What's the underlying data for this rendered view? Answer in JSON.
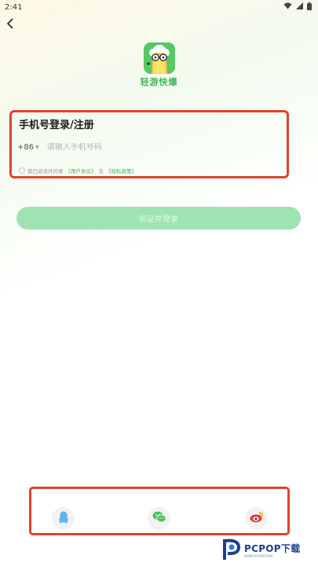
{
  "status_bar": {
    "time": "2:41",
    "icons": [
      "wifi-icon",
      "signal-icon",
      "battery-icon"
    ]
  },
  "app": {
    "name": "轻游快爆",
    "logo_icon": "sheep-mascot-icon",
    "logo_color": "#57c768"
  },
  "login": {
    "title": "手机号登录/注册",
    "country_code": "+86",
    "phone_placeholder": "请输入手机号码",
    "agreement_prefix": "我已阅读并同意",
    "user_agreement": "《用户协议》",
    "agreement_join": "及",
    "privacy_policy": "《隐私政策》",
    "submit_label": "验证并登录",
    "submit_color": "#9fe3b3"
  },
  "social_login": {
    "options": [
      "qq-icon",
      "wechat-icon",
      "weibo-icon"
    ]
  },
  "watermark": {
    "logo_icon": "pcpop-logo-icon",
    "text": "PCPOP下载",
    "subtext": "WWW.PCPOP.COM"
  },
  "colors": {
    "accent": "#3cb85a",
    "highlight_border": "#e2412b"
  }
}
